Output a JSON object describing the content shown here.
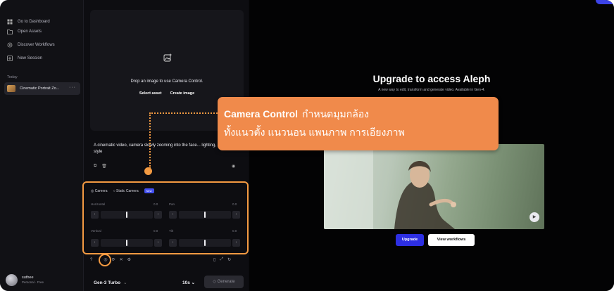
{
  "sidebar": {
    "items": [
      {
        "label": "Go to Dashboard",
        "icon": "dashboard-icon"
      },
      {
        "label": "Open Assets",
        "icon": "folder-icon"
      },
      {
        "label": "Discover Workflows",
        "icon": "workflow-icon"
      },
      {
        "label": "New Session",
        "icon": "plus-icon"
      }
    ],
    "section_today": "Today",
    "session_label": "Cinematic Portrait Zo...",
    "session_more": "···",
    "user_name": "suthee",
    "user_plan": "Personal · Free"
  },
  "composer": {
    "drop_text": "Drop an image to use Camera Control.",
    "select_asset": "Select asset",
    "create_image": "Create image",
    "prompt": "A cinematic video, camera slowly zooming into the face... lighting, realistic style"
  },
  "camera": {
    "tab_camera": "Camera",
    "tab_static": "Static Camera",
    "badge_new": "New",
    "horizontal_label": "Horizontal",
    "horizontal_value": "0.0",
    "pan_label": "Pan",
    "pan_value": "0.0",
    "vertical_label": "Vertical",
    "vertical_value": "0.0",
    "tilt_label": "Tilt",
    "tilt_value": "0.0"
  },
  "bottom": {
    "model": "Gen-3 Turbo",
    "duration": "10s",
    "generate": "Generate"
  },
  "upsell": {
    "title": "Upgrade to access Aleph",
    "subtitle": "A new way to edit, transform and generate video. Available in Gen-4.",
    "upgrade_button": "Upgrade",
    "workflows_button": "View workflows"
  },
  "callout": {
    "bold_text": "Camera Control",
    "line1_rest": "กำหนดมุมกล้อง",
    "line2": "ทั้งแนวตั้ง แนวนอน แพนภาพ การเอียงภาพ"
  },
  "colors": {
    "accent_orange": "#f08a4b",
    "upgrade_blue": "#2d2fe3"
  }
}
